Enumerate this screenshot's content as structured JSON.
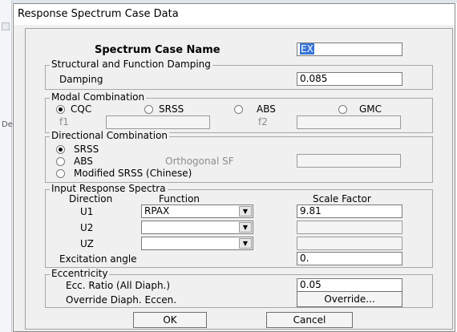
{
  "window": {
    "title": "Response Spectrum Case Data"
  },
  "background": {
    "side_text": "De"
  },
  "spectrum_case": {
    "label": "Spectrum Case Name",
    "value": "EX"
  },
  "damping": {
    "group_title": "Structural and Function Damping",
    "label": "Damping",
    "value": "0.085"
  },
  "modal": {
    "group_title": "Modal Combination",
    "options": [
      {
        "label": "CQC",
        "selected": true
      },
      {
        "label": "SRSS",
        "selected": false
      },
      {
        "label": "ABS",
        "selected": false
      },
      {
        "label": "GMC",
        "selected": false
      }
    ],
    "f1_label": "f1",
    "f1_value": "",
    "f2_label": "f2",
    "f2_value": ""
  },
  "directional": {
    "group_title": "Directional Combination",
    "srss_label": "SRSS",
    "abs_label": "ABS",
    "orth_label": "Orthogonal SF",
    "orth_value": "",
    "modified_label": "Modified SRSS (Chinese)"
  },
  "input_spectra": {
    "group_title": "Input Response Spectra",
    "headers": {
      "direction": "Direction",
      "function": "Function",
      "scale": "Scale Factor"
    },
    "rows": [
      {
        "direction": "U1",
        "function": "RPAX",
        "scale": "9.81"
      },
      {
        "direction": "U2",
        "function": "",
        "scale": ""
      },
      {
        "direction": "UZ",
        "function": "",
        "scale": ""
      }
    ],
    "excitation_label": "Excitation  angle",
    "excitation_value": "0."
  },
  "eccentricity": {
    "group_title": "Eccentricity",
    "ratio_label": "Ecc. Ratio (All Diaph.)",
    "ratio_value": "0.05",
    "override_label": "Override Diaph. Eccen.",
    "override_button": "Override..."
  },
  "buttons": {
    "ok": "OK",
    "cancel": "Cancel"
  }
}
